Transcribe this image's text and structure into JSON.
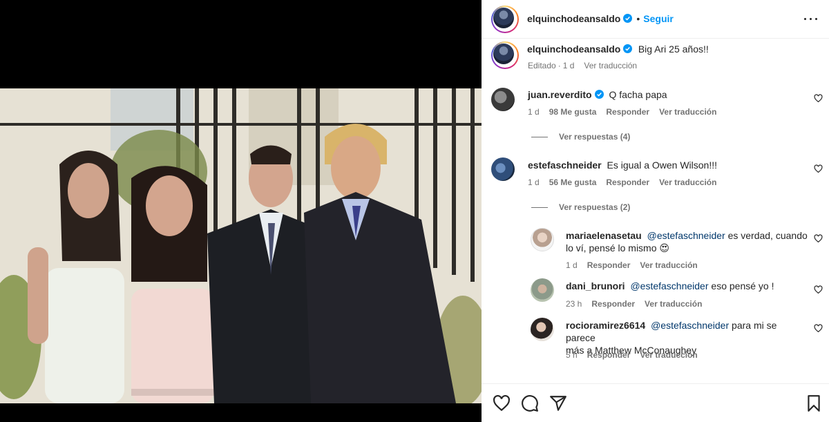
{
  "post": {
    "author": "elquinchodeansaldo",
    "follow_label": "Seguir",
    "dot": "•",
    "caption_text": "Big Ari 25 años!!",
    "caption_meta_prefix": "Editado",
    "caption_time": "1 d",
    "translate_label": "Ver traducción"
  },
  "comments": [
    {
      "user": "juan.reverdito",
      "verified": true,
      "text": "Q facha papa",
      "time": "1 d",
      "likes": "98 Me gusta",
      "reply": "Responder",
      "translate": "Ver traducción",
      "view_replies": "Ver respuestas (4)"
    },
    {
      "user": "estefaschneider",
      "verified": false,
      "text": "Es igual a Owen Wilson!!!",
      "time": "1 d",
      "likes": "56 Me gusta",
      "reply": "Responder",
      "translate": "Ver traducción",
      "view_replies": "Ver respuestas (2)"
    }
  ],
  "replies": [
    {
      "user": "mariaelenasetau",
      "mention": "@estefaschneider",
      "text_line1": " es verdad, cuando",
      "text_line2": "lo ví, pensé lo mismo",
      "emoji": "😍",
      "time": "1 d",
      "reply": "Responder",
      "translate": "Ver traducción"
    },
    {
      "user": "dani_brunori",
      "mention": "@estefaschneider",
      "text_line1": " eso pensé yo !",
      "time": "23 h",
      "reply": "Responder",
      "translate": "Ver traducción"
    },
    {
      "user": "rocioramirez6614",
      "mention": "@estefaschneider",
      "text_line1": " para mi se parece",
      "text_line2": "más a Matthew McConaughey",
      "time": "5 h",
      "reply": "Responder",
      "translate": "Ver traducción"
    }
  ],
  "icons": {
    "like": "heart-icon",
    "comment": "comment-icon",
    "share": "share-icon",
    "save": "bookmark-icon",
    "more": "more-options-icon",
    "verified": "verified-badge-icon"
  },
  "colors": {
    "link": "#0095f6",
    "verified": "#0095f6",
    "muted": "#737373",
    "text": "#262626"
  }
}
